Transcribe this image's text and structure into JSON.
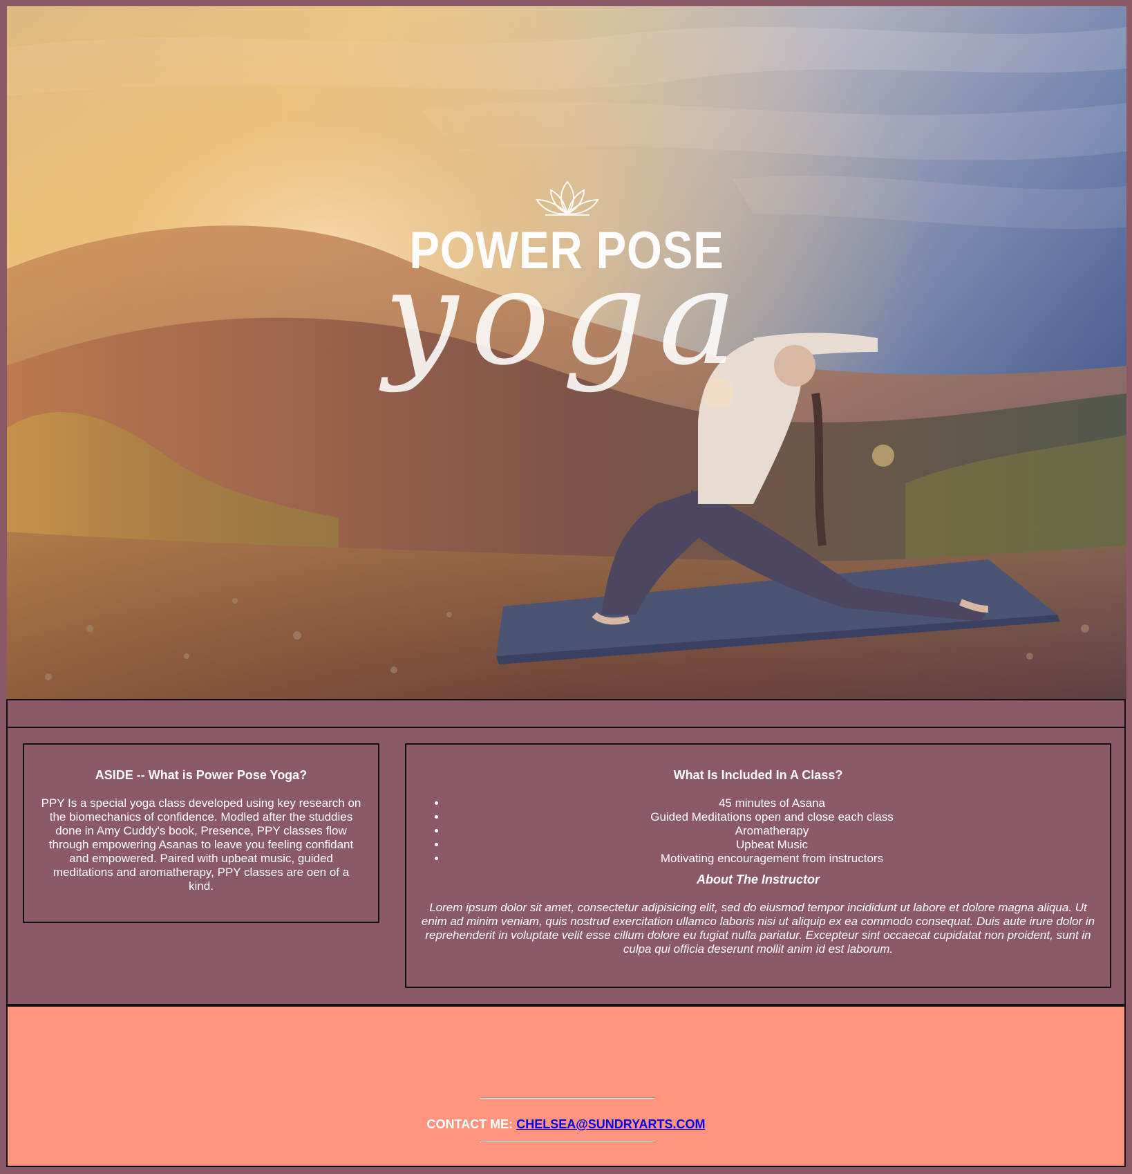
{
  "hero": {
    "logo_title": "POWER POSE",
    "logo_script": "yoga",
    "logo_icon": "lotus-icon"
  },
  "aside": {
    "heading": "ASIDE -- What is Power Pose Yoga?",
    "body": "PPY Is a special yoga class developed using key research on the biomechanics of confidence. Modled after the studdies done in Amy Cuddy's book, Presence, PPY classes flow through empowering Asanas to leave you feeling confidant and empowered. Paired with upbeat music, guided meditations and aromatherapy, PPY classes are oen of a kind."
  },
  "section": {
    "heading": "What Is Included In A Class?",
    "items": [
      "45 minutes of Asana",
      "Guided Meditations open and close each class",
      "Aromatherapy",
      "Upbeat Music",
      "Motivating encouragement from instructors"
    ],
    "instructor_heading": "About The Instructor",
    "instructor_body": "Lorem ipsum dolor sit amet, consectetur adipisicing elit, sed do eiusmod tempor incididunt ut labore et dolore magna aliqua. Ut enim ad minim veniam, quis nostrud exercitation ullamco laboris nisi ut aliquip ex ea commodo consequat. Duis aute irure dolor in reprehenderit in voluptate velit esse cillum dolore eu fugiat nulla pariatur. Excepteur sint occaecat cupidatat non proident, sunt in culpa qui officia deserunt mollit anim id est laborum."
  },
  "footer": {
    "contact_label": "CONTACT ME:",
    "contact_email": "CHELSEA@SUNDRYARTS.COM"
  },
  "colors": {
    "page_background": "#8c5969",
    "footer_background": "#ff957f",
    "link": "#0000ee"
  }
}
